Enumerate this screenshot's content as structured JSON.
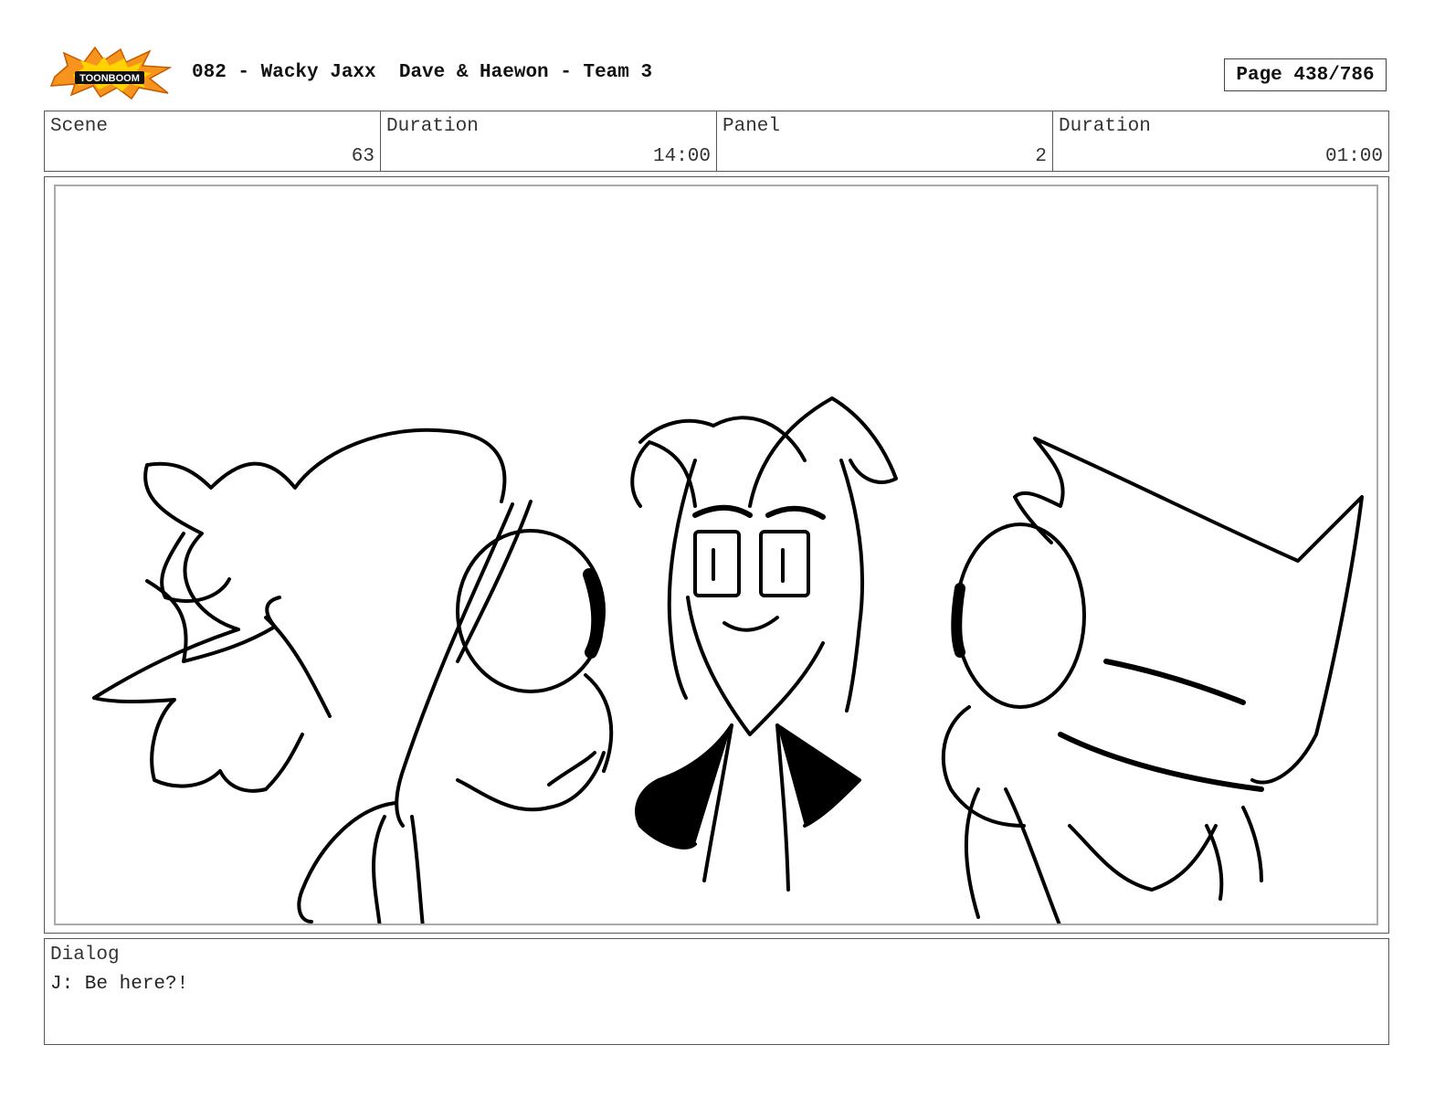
{
  "header": {
    "logo_text": "TOONBOOM",
    "title": "082 - Wacky Jaxx  Dave & Haewon - Team 3",
    "page": "Page 438/786"
  },
  "info": {
    "scene_label": "Scene",
    "scene_value": "63",
    "duration_label": "Duration",
    "duration_value": "14:00",
    "panel_label": "Panel",
    "panel_value": "2",
    "panel_duration_label": "Duration",
    "panel_duration_value": "01:00"
  },
  "dialog": {
    "label": "Dialog",
    "text": "J: Be here?!"
  },
  "colors": {
    "logo_orange": "#f7941d",
    "logo_yellow": "#ffd200",
    "ink": "#000000"
  }
}
